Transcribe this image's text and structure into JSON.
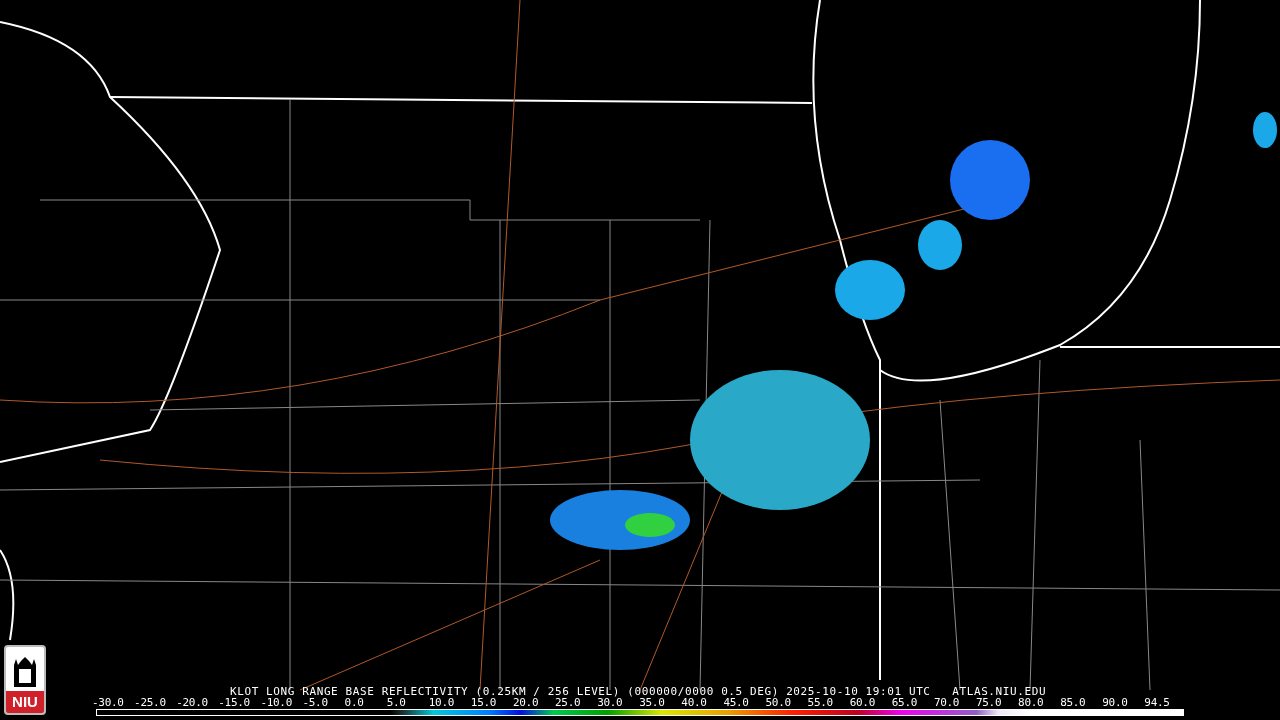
{
  "logo": {
    "text": "NIU"
  },
  "caption": "KLOT LONG RANGE BASE REFLECTIVITY (0.25KM / 256 LEVEL) (000000/0000 0.5 DEG) 2025-10-10 19:01 UTC   ATLAS.NIU.EDU",
  "scale": {
    "labels": [
      "-30.0",
      "-25.0",
      "-20.0",
      "-15.0",
      "-10.0",
      "-5.0",
      "0.0",
      "5.0",
      "10.0",
      "15.0",
      "20.0",
      "25.0",
      "30.0",
      "35.0",
      "40.0",
      "45.0",
      "50.0",
      "55.0",
      "60.0",
      "65.0",
      "70.0",
      "75.0",
      "80.0",
      "85.0",
      "90.0",
      "94.5"
    ]
  }
}
